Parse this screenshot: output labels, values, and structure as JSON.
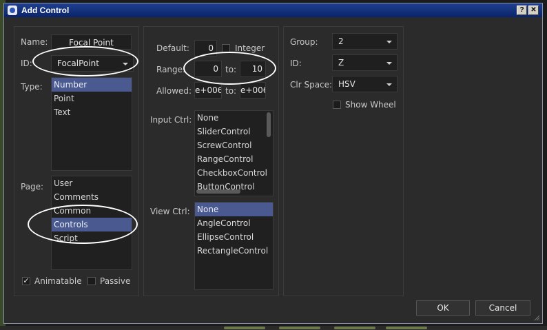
{
  "window": {
    "title": "Add Control",
    "help_glyph": "?",
    "close_glyph": "✕"
  },
  "left": {
    "name_label": "Name:",
    "name_value": "Focal Point",
    "id_label": "ID:",
    "id_value": "FocalPoint",
    "type_label": "Type:",
    "types": [
      "Number",
      "Point",
      "Text"
    ],
    "type_selected": 0,
    "page_label": "Page:",
    "pages": [
      "User",
      "Comments",
      "Common",
      "Controls",
      "Script"
    ],
    "page_selected": 3,
    "animatable_label": "Animatable",
    "animatable_checked": true,
    "passive_label": "Passive",
    "passive_checked": false
  },
  "middle": {
    "default_label": "Default:",
    "default_value": "0",
    "integer_label": "Integer",
    "integer_checked": false,
    "range_label": "Range:",
    "range_from": "0",
    "range_to_label": "to:",
    "range_to": "10",
    "allowed_label": "Allowed:",
    "allowed_from": "e+006",
    "allowed_to_label": "to:",
    "allowed_to": "e+006",
    "input_ctrl_label": "Input Ctrl:",
    "input_ctrls": [
      "None",
      "SliderControl",
      "ScrewControl",
      "RangeControl",
      "CheckboxControl",
      "ButtonControl"
    ],
    "view_ctrl_label": "View Ctrl:",
    "view_ctrls": [
      "None",
      "AngleControl",
      "EllipseControl",
      "RectangleControl"
    ],
    "view_ctrl_selected": 0
  },
  "right": {
    "group_label": "Group:",
    "group_value": "2",
    "id_label": "ID:",
    "id_value": "Z",
    "clrspace_label": "Clr Space:",
    "clrspace_value": "HSV",
    "showwheel_label": "Show Wheel",
    "showwheel_checked": false
  },
  "buttons": {
    "ok": "OK",
    "cancel": "Cancel"
  },
  "colors": {
    "title_bar": "#0a246a",
    "selection": "#4a5a90",
    "background": "#2b2b2b"
  }
}
